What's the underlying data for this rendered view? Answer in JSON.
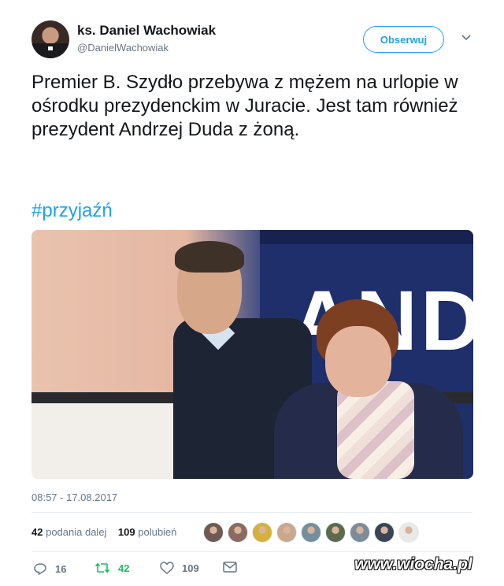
{
  "tweet": {
    "author_name": "ks. Daniel Wachowiak",
    "author_handle": "@DanielWachowiak",
    "follow_label": "Obserwuj",
    "text": "Premier B. Szydło przebywa z mężem na urlopie w ośrodku prezydenckim w Juracie. Jest tam również prezydent Andrzej Duda z żoną.",
    "hashtag": "#przyjaźń",
    "image": {
      "bus_text": "ANDR",
      "description_icon": "photo-icon"
    },
    "timestamp": "08:57 - 17.08.2017",
    "stats": {
      "retweets_count": "42",
      "retweets_label": "podania dalej",
      "likes_count": "109",
      "likes_label": "polubień"
    },
    "liker_avatars": [
      {
        "color": "#6e5a52"
      },
      {
        "color": "#8b6a60"
      },
      {
        "color": "#d5b03a"
      },
      {
        "color": "#caa890"
      },
      {
        "color": "#748e9e"
      },
      {
        "color": "#5c6b4b"
      },
      {
        "color": "#7e8c98"
      },
      {
        "color": "#394455"
      },
      {
        "color": "#e9e9e9"
      }
    ],
    "actions": {
      "reply_count": "16",
      "retweet_count": "42",
      "like_count": "109"
    }
  },
  "watermark": "www.wiocha.pl",
  "colors": {
    "accent": "#1da1f2",
    "retweet": "#17bf63",
    "secondary_text": "#657786"
  }
}
